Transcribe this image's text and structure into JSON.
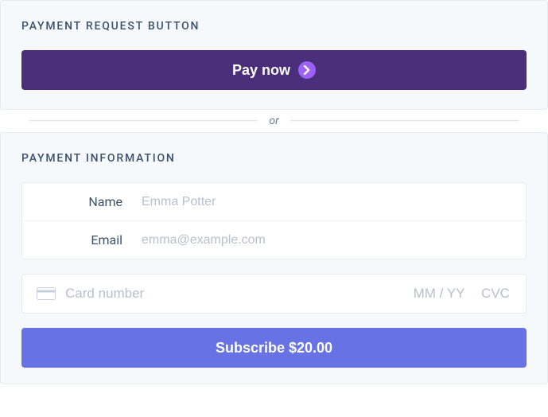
{
  "prb": {
    "title": "PAYMENT REQUEST BUTTON",
    "pay_now": "Pay now"
  },
  "divider": "or",
  "info": {
    "title": "PAYMENT INFORMATION",
    "name_label": "Name",
    "name_placeholder": "Emma Potter",
    "email_label": "Email",
    "email_placeholder": "emma@example.com",
    "card_number_placeholder": "Card number",
    "mmyy_placeholder": "MM / YY",
    "cvc_placeholder": "CVC",
    "subscribe_label": "Subscribe $20.00"
  }
}
